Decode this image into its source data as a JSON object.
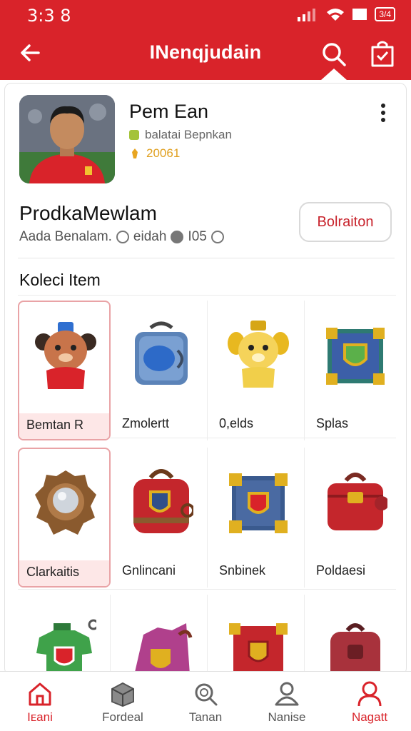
{
  "status_bar": {
    "time": "3:3 8",
    "battery": "3/4"
  },
  "app_bar": {
    "title": "INenqjudain"
  },
  "profile": {
    "name": "Pem Ean",
    "tag": "balatai Bepnkan",
    "coins": "20061"
  },
  "shop": {
    "title": "ProdkaMewlam",
    "meta_text": "Aada Benalam.",
    "meta_text2": "eidah",
    "meta_count": "I05",
    "follow_label": "Bolraiton"
  },
  "section_title": "Koleci Item",
  "items": [
    {
      "label": "Bemtan R",
      "icon": "bear-mascot-icon"
    },
    {
      "label": "Zmolertt",
      "icon": "blue-safe-icon"
    },
    {
      "label": "0,elds",
      "icon": "golden-bear-icon"
    },
    {
      "label": "Splas",
      "icon": "treasure-chest-icon"
    },
    {
      "label": "Clarkaitis",
      "icon": "stone-orb-icon"
    },
    {
      "label": "Gnlincani",
      "icon": "red-backpack-icon"
    },
    {
      "label": "Snbinek",
      "icon": "blue-chest-icon"
    },
    {
      "label": "Poldaesi",
      "icon": "red-bag-icon"
    },
    {
      "label": "",
      "icon": "green-jersey-icon"
    },
    {
      "label": "",
      "icon": "purple-cape-icon"
    },
    {
      "label": "",
      "icon": "red-crate-icon"
    },
    {
      "label": "",
      "icon": "maroon-pack-icon"
    }
  ],
  "bottom_nav": [
    {
      "label": "Iᴇani",
      "icon": "home-icon",
      "active": true
    },
    {
      "label": "Fordeal",
      "icon": "box-icon",
      "active": false
    },
    {
      "label": "Tanan",
      "icon": "search-icon",
      "active": false
    },
    {
      "label": "Nanise",
      "icon": "person-outline-icon",
      "active": false
    },
    {
      "label": "Nagatt",
      "icon": "profile-icon",
      "active": true
    }
  ],
  "colors": {
    "brand_red": "#d9232a",
    "highlight_pink": "#fde7e7"
  }
}
